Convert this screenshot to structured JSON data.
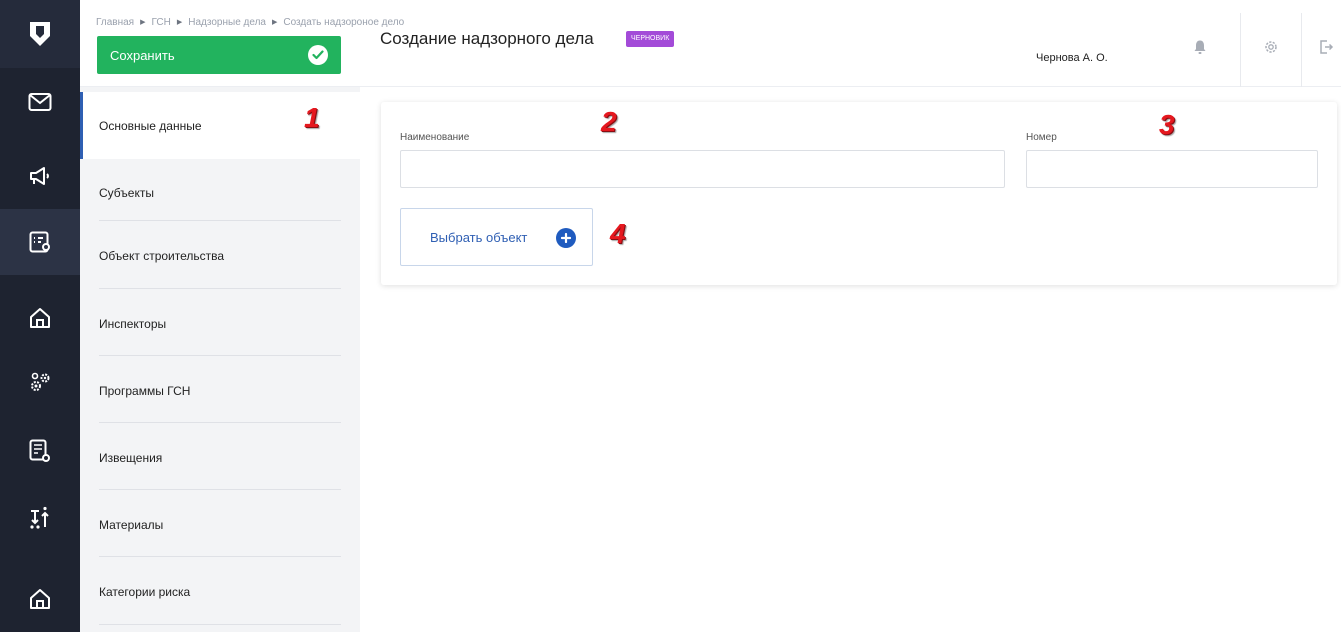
{
  "breadcrumb": {
    "items": [
      "Главная",
      "ГСН",
      "Надзорные дела",
      "Создать надзороное дело"
    ]
  },
  "toolbar": {
    "save_label": "Сохранить"
  },
  "header": {
    "title": "Создание надзорного дела",
    "status_badge": "ЧЕРНОВИК",
    "user_name": "Чернова А. О."
  },
  "sections": {
    "items": [
      {
        "label": "Основные данные"
      },
      {
        "label": "Субъекты"
      },
      {
        "label": "Объект строительства"
      },
      {
        "label": "Инспекторы"
      },
      {
        "label": "Программы ГСН"
      },
      {
        "label": "Извещения"
      },
      {
        "label": "Материалы"
      },
      {
        "label": "Категории риска"
      }
    ]
  },
  "form": {
    "name_label": "Наименование",
    "name_value": "",
    "number_label": "Номер",
    "number_value": "",
    "choose_object_label": "Выбрать объект"
  },
  "annotations": [
    "1",
    "2",
    "3",
    "4"
  ],
  "colors": {
    "rail_bg": "#1e2330",
    "save_green": "#22b35e",
    "badge_purple": "#a34bd8",
    "accent_blue": "#2f5fb3",
    "annotation_red": "#e5181f"
  },
  "icons": {
    "rail": [
      "shield-logo-icon",
      "envelope-icon",
      "megaphone-icon",
      "checklist-icon",
      "home-icon",
      "gears-icon",
      "document-search-icon",
      "sort-arrows-icon",
      "home-icon"
    ],
    "top": [
      "bell-icon",
      "gear-icon",
      "logout-icon"
    ]
  }
}
